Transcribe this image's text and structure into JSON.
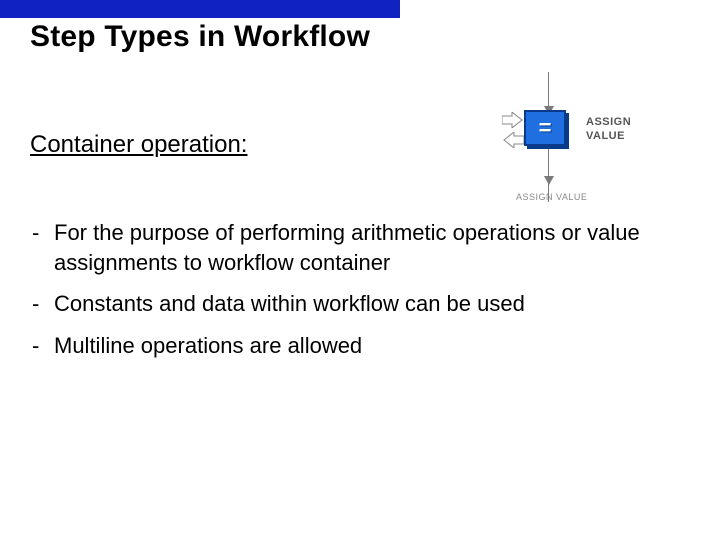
{
  "title": "Step Types in Workflow",
  "subtitle": "Container operation:",
  "diagram": {
    "icon_symbol": "=",
    "label_right": "ASSIGN\nVALUE",
    "label_bottom": "ASSIGN VALUE"
  },
  "bullets": [
    "For the purpose of performing arithmetic operations or value assignments to workflow container",
    "Constants and data within workflow can be used",
    "Multiline operations are allowed"
  ]
}
